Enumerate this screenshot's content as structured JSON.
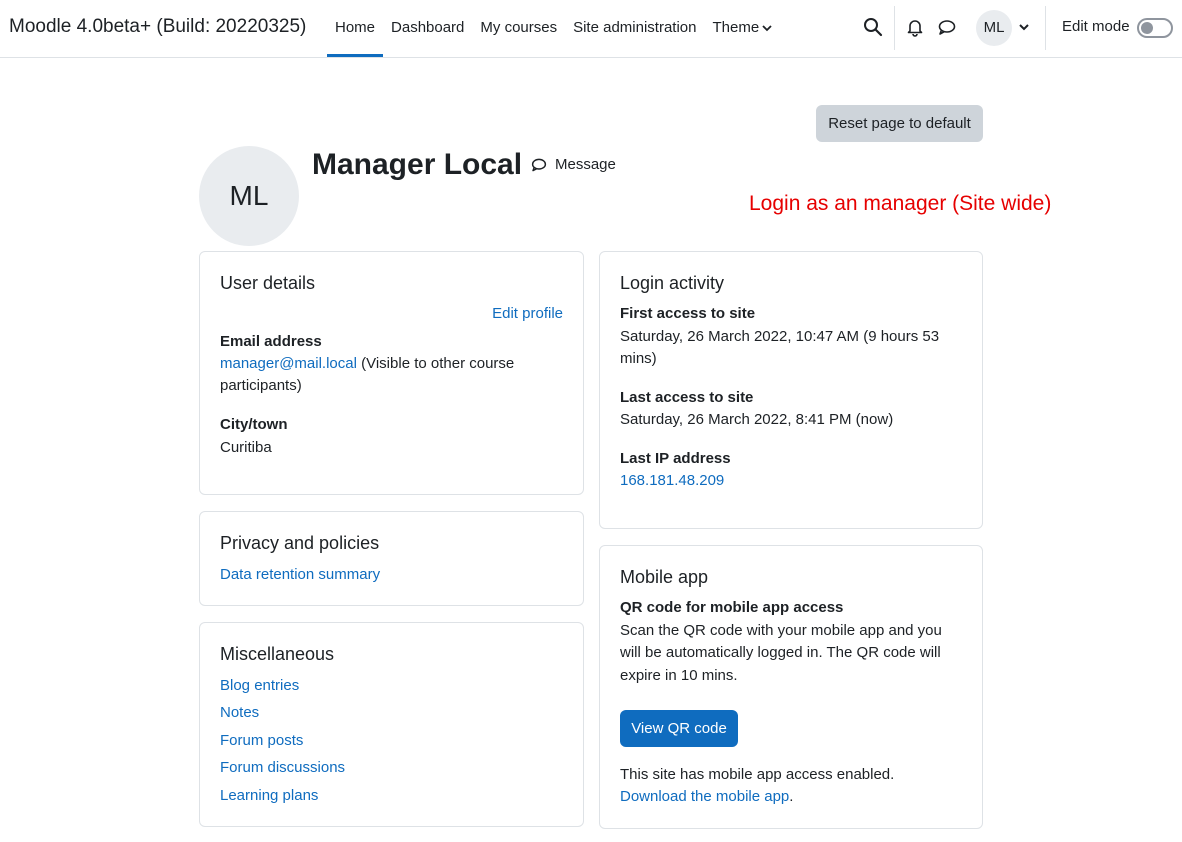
{
  "navbar": {
    "brand": "Moodle 4.0beta+ (Build: 20220325)",
    "items": [
      {
        "label": "Home",
        "active": true
      },
      {
        "label": "Dashboard"
      },
      {
        "label": "My courses"
      },
      {
        "label": "Site administration"
      },
      {
        "label": "Theme"
      }
    ],
    "avatar_initials": "ML",
    "edit_mode_label": "Edit mode",
    "edit_mode_on": false,
    "icons": [
      "search-icon",
      "bell-icon",
      "chat-bubble-icon",
      "chevron-down-icon"
    ]
  },
  "header": {
    "reset_label": "Reset page to default",
    "avatar_initials": "ML",
    "user_name": "Manager Local",
    "message_label": "Message",
    "annotation": "Login as an manager (Site wide)"
  },
  "user_details": {
    "title": "User details",
    "edit_profile": "Edit profile",
    "email_label": "Email address",
    "email_value": "manager@mail.local",
    "email_note_1": "(Visible to other course",
    "email_note_2": "participants)",
    "city_label": "City/town",
    "city_value": "Curitiba"
  },
  "privacy": {
    "title": "Privacy and policies",
    "link": "Data retention summary"
  },
  "misc": {
    "title": "Miscellaneous",
    "links": [
      "Blog entries",
      "Notes",
      "Forum posts",
      "Forum discussions",
      "Learning plans"
    ]
  },
  "login_activity": {
    "title": "Login activity",
    "first_label": "First access to site",
    "first_value_1": "Saturday, 26 March 2022, 10:47 AM  (9 hours 53",
    "first_value_2": "mins)",
    "last_label": "Last access to site",
    "last_value": "Saturday, 26 March 2022, 8:41 PM  (now)",
    "ip_label": "Last IP address",
    "ip_value": "168.181.48.209"
  },
  "mobile_app": {
    "title": "Mobile app",
    "qr_label": "QR code for mobile app access",
    "desc_1": "Scan the QR code with your mobile app and you",
    "desc_2": "will be automatically logged in. The QR code will",
    "desc_3": "expire in 10 mins.",
    "view_qr": "View QR code",
    "enabled_text": "This site has mobile app access enabled.",
    "download_link": "Download the mobile app",
    "download_suffix": "."
  },
  "colors": {
    "link": "#0f6cbf",
    "annotation": "#e60000",
    "avatar_bg": "#e9ecef",
    "reset_bg": "#ced4da"
  }
}
